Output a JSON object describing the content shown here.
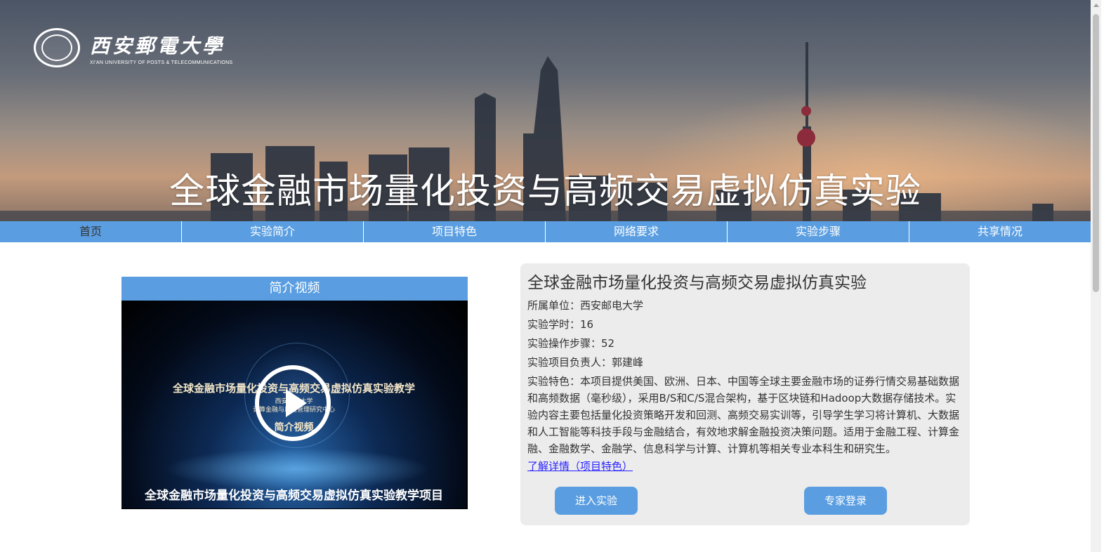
{
  "header": {
    "logo": {
      "name_cn": "西安郵電大學",
      "name_en": "XI'AN UNIVERSITY OF POSTS & TELECOMMUNICATIONS"
    },
    "title": "全球金融市场量化投资与高频交易虚拟仿真实验"
  },
  "nav": {
    "items": [
      {
        "label": "首页",
        "active": true
      },
      {
        "label": "实验简介"
      },
      {
        "label": "项目特色"
      },
      {
        "label": "网络要求"
      },
      {
        "label": "实验步骤"
      },
      {
        "label": "共享情况"
      }
    ]
  },
  "video": {
    "header": "简介视频",
    "frame_title": "全球金融市场量化投资与高频交易虚拟仿真实验教学",
    "frame_sub_1": "西安邮电大学",
    "frame_sub_2": "计算金融与风险管理研究中心",
    "frame_label": "简介视频",
    "caption": "全球金融市场量化投资与高频交易虚拟仿真实验教学项目"
  },
  "info": {
    "title": "全球金融市场量化投资与高频交易虚拟仿真实验",
    "unit": "所属单位：西安邮电大学",
    "hours": "实验学时：16",
    "steps": "实验操作步骤：52",
    "leader": "实验项目负责人：郭建峰",
    "features": "实验特色：本项目提供美国、欧洲、日本、中国等全球主要金融市场的证券行情交易基础数据和高频数据（毫秒级），采用B/S和C/S混合架构，基于区块链和Hadoop大数据存储技术。实验内容主要包括量化投资策略开发和回测、高频交易实训等，引导学生学习将计算机、大数据和人工智能等科技手段与金融结合，有效地求解金融投资决策问题。适用于金融工程、计算金融、金融数学、金融学、信息科学与计算、计算机等相关专业本科生和研究生。",
    "more_link": "了解详情（项目特色）",
    "enter_button": "进入实验",
    "expert_button": "专家登录"
  },
  "colors": {
    "nav_bg": "#5a9ee1",
    "card_bg": "#ececec",
    "link": "#2a22ff"
  }
}
